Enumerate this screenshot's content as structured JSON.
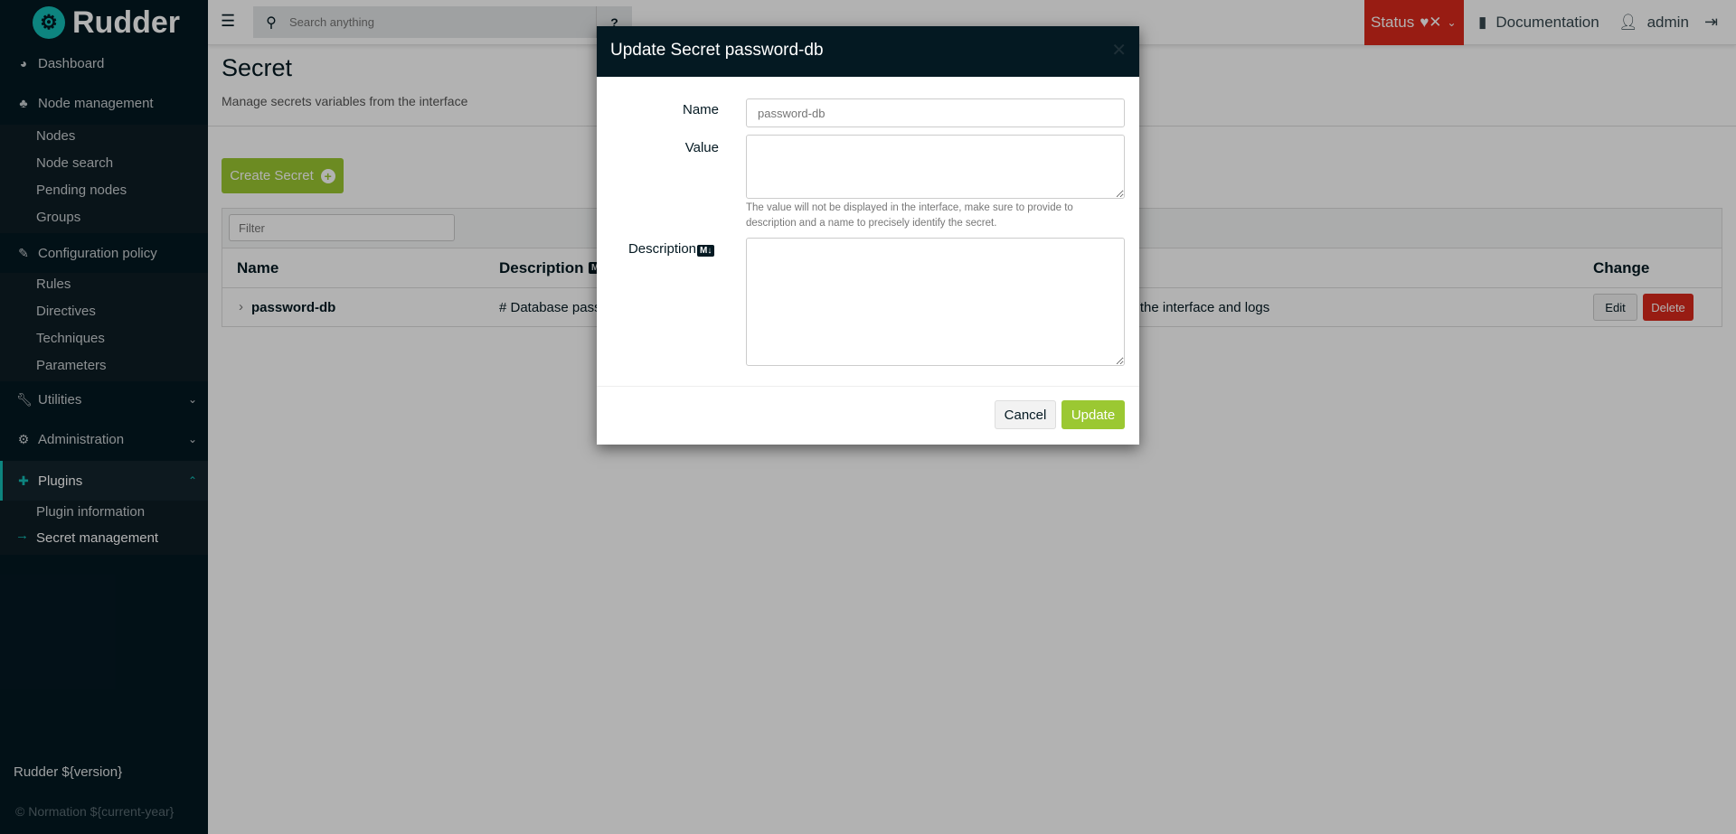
{
  "app": {
    "name": "Rudder"
  },
  "search": {
    "placeholder": "Search anything"
  },
  "topbar": {
    "status": "Status",
    "documentation": "Documentation",
    "user": "admin"
  },
  "sidebar": {
    "items": [
      {
        "label": "Dashboard"
      },
      {
        "label": "Node management",
        "children": [
          "Nodes",
          "Node search",
          "Pending nodes",
          "Groups"
        ]
      },
      {
        "label": "Configuration policy",
        "children": [
          "Rules",
          "Directives",
          "Techniques",
          "Parameters"
        ]
      },
      {
        "label": "Utilities"
      },
      {
        "label": "Administration"
      },
      {
        "label": "Plugins",
        "children": [
          "Plugin information",
          "Secret management"
        ]
      }
    ],
    "version": "Rudder ${version}",
    "copyright": "© Normation ${current-year}"
  },
  "page": {
    "title": "Secret",
    "subtitle": "Manage secrets variables from the interface",
    "create_label": "Create Secret"
  },
  "table": {
    "filter_placeholder": "Filter",
    "headers": {
      "name": "Name",
      "description": "Description",
      "change": "Change"
    },
    "markdown_badge": "M↓",
    "rows": [
      {
        "name": "password-db",
        "description_start": "# Database passw",
        "description_end": "in the interface and logs",
        "edit": "Edit",
        "delete": "Delete"
      }
    ]
  },
  "modal": {
    "title": "Update Secret password-db",
    "name_label": "Name",
    "name_placeholder": "password-db",
    "value_label": "Value",
    "value_help": "The value will not be displayed in the interface, make sure to provide to description and a name to precisely identify the secret.",
    "description_label": "Description",
    "markdown_badge": "M↓",
    "cancel": "Cancel",
    "update": "Update"
  },
  "colors": {
    "brand": "#13beb7",
    "sidebar": "#041922",
    "primary": "#9bc832",
    "danger": "#da291c"
  }
}
